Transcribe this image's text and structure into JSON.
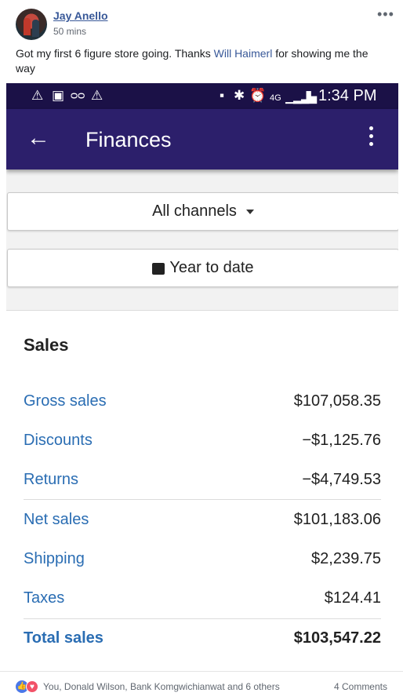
{
  "post": {
    "author": "Jay Anello",
    "time": "50 mins",
    "text_before": "Got my first 6 figure store going. Thanks ",
    "mention": "Will Haimerl",
    "text_after": " for showing me the way",
    "more_icon": "more-horizontal-icon"
  },
  "phone": {
    "status_bar": {
      "time": "1:34 PM",
      "left_icons": [
        "warning-icon",
        "image-icon",
        "incognito-icon",
        "warning-icon"
      ],
      "right_icons": [
        "battery-saver-icon",
        "bluetooth-icon",
        "alarm-icon",
        "lte-icon",
        "signal-icon",
        "battery-icon"
      ]
    },
    "app_bar": {
      "title": "Finances",
      "back_icon": "back-arrow-icon",
      "menu_icon": "kebab-menu-icon"
    },
    "filters": {
      "channels_label": "All channels",
      "date_label": "Year to date"
    },
    "sales": {
      "title": "Sales",
      "rows": [
        {
          "label": "Gross sales",
          "value": "$107,058.35"
        },
        {
          "label": "Discounts",
          "value": "−$1,125.76"
        },
        {
          "label": "Returns",
          "value": "−$4,749.53"
        },
        {
          "label": "Net sales",
          "value": "$101,183.06"
        },
        {
          "label": "Shipping",
          "value": "$2,239.75"
        },
        {
          "label": "Taxes",
          "value": "$124.41"
        },
        {
          "label": "Total sales",
          "value": "$103,547.22"
        }
      ]
    },
    "colors": {
      "status_bar": "#1b1147",
      "app_bar": "#2c1f6b",
      "link_label": "#2a6db3"
    }
  },
  "reactions": {
    "names": "You, Donald Wilson, Bank Komgwichianwat and 6 others",
    "comments": "4 Comments"
  }
}
